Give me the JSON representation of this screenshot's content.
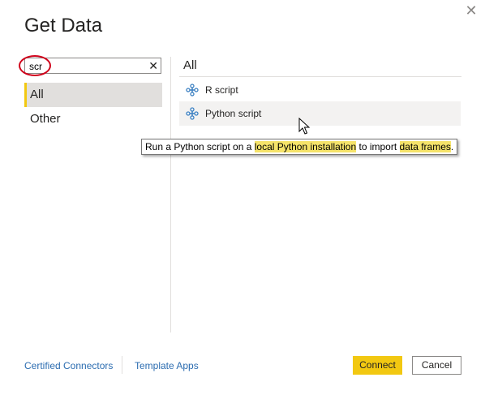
{
  "dialog": {
    "title": "Get Data",
    "close_icon": "close-icon"
  },
  "search": {
    "value": "scr",
    "clear_icon": "clear-x-icon"
  },
  "categories": [
    {
      "label": "All",
      "selected": true
    },
    {
      "label": "Other",
      "selected": false
    }
  ],
  "results": {
    "section_title": "All",
    "items": [
      {
        "label": "R script",
        "icon": "script-connector-icon"
      },
      {
        "label": "Python script",
        "icon": "script-connector-icon",
        "hovered": true
      }
    ]
  },
  "tooltip": {
    "parts": [
      {
        "text": "Run a Python script on a ",
        "highlight": false
      },
      {
        "text": "local Python installation",
        "highlight": true
      },
      {
        "text": " to import ",
        "highlight": false
      },
      {
        "text": "data frames",
        "highlight": true
      },
      {
        "text": ".",
        "highlight": false
      }
    ]
  },
  "footer": {
    "links": [
      "Certified Connectors",
      "Template Apps"
    ],
    "connect_label": "Connect",
    "cancel_label": "Cancel"
  },
  "colors": {
    "accent": "#f2c811",
    "highlight": "#f5e36a",
    "link": "#2b6cb0",
    "annotation": "#d0021b"
  }
}
